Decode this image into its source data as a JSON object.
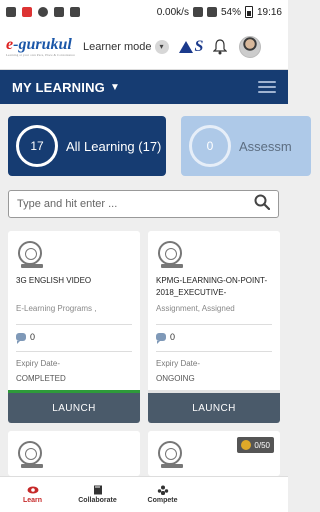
{
  "status_bar": {
    "speed": "0.00k/s",
    "battery": "54%",
    "time": "19:16"
  },
  "header": {
    "logo_text": "gurukul",
    "logo_prefix": "e",
    "logo_tagline": "Learning at your own Pace, Place & Convenience",
    "mode_label": "Learner mode"
  },
  "page": {
    "title": "MY LEARNING"
  },
  "tiles": [
    {
      "count": "17",
      "label": "All Learning (17)"
    },
    {
      "count": "0",
      "label": "Assessm"
    }
  ],
  "search": {
    "placeholder": "Type and hit enter ..."
  },
  "cards": [
    {
      "title": "3G ENGLISH VIDEO",
      "subtitle": "E-Learning Programs ,",
      "comments": "0",
      "expiry_label": "Expiry Date-",
      "status": "COMPLETED",
      "progress": 1.0,
      "button": "LAUNCH"
    },
    {
      "title": "KPMG-LEARNING-ON-POINT-2018_EXECUTIVE-",
      "subtitle": "Assignment, Assigned",
      "comments": "0",
      "expiry_label": "Expiry Date-",
      "status": "ONGOING",
      "progress": 0.0,
      "button": "LAUNCH"
    },
    {
      "points": "0/50"
    }
  ],
  "bottom_nav": [
    {
      "label": "Learn",
      "active": true
    },
    {
      "label": "Collaborate",
      "active": false
    },
    {
      "label": "Compete",
      "active": false
    }
  ],
  "colors": {
    "primary": "#163c72",
    "accent": "#c62828",
    "progress": "#2e9a3a"
  }
}
